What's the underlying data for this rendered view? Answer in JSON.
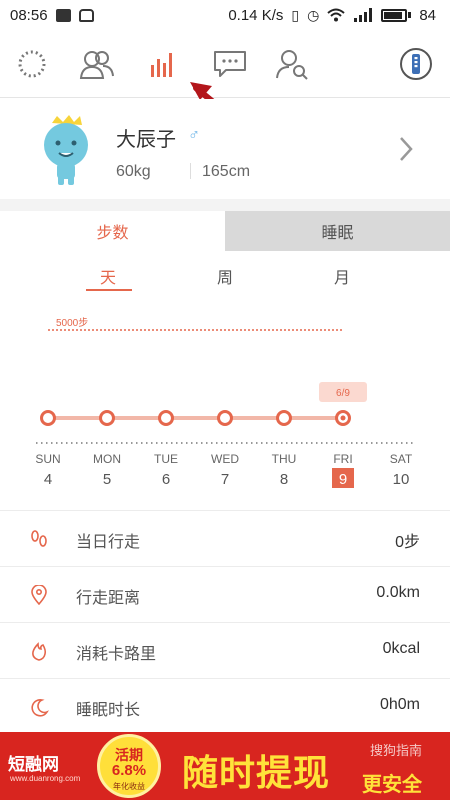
{
  "status_bar": {
    "time": "08:56",
    "speed": "0.14 K/s",
    "battery": "84"
  },
  "profile": {
    "name": "大辰子",
    "gender_symbol": "♂",
    "weight": "60kg",
    "height": "165cm"
  },
  "segment_tabs": {
    "steps": "步数",
    "sleep": "睡眠"
  },
  "period_tabs": {
    "day": "天",
    "week": "周",
    "month": "月"
  },
  "chart_data": {
    "type": "line",
    "goal_label": "5000步",
    "selected_label": "6/9",
    "categories": [
      "SUN",
      "MON",
      "TUE",
      "WED",
      "THU",
      "FRI",
      "SAT"
    ],
    "dates": [
      "4",
      "5",
      "6",
      "7",
      "8",
      "9",
      "10"
    ],
    "values": [
      0,
      0,
      0,
      0,
      0,
      0
    ],
    "goal": 5000,
    "selected_index": 5,
    "ylim": [
      0,
      5000
    ],
    "colors": {
      "accent": "#e5674c",
      "line": "#f2b7a8",
      "goal": "#e5674c"
    }
  },
  "stats": [
    {
      "label": "当日行走",
      "value": "0步",
      "icon": "footprints-icon"
    },
    {
      "label": "行走距离",
      "value": "0.0km",
      "icon": "location-pin-icon"
    },
    {
      "label": "消耗卡路里",
      "value": "0kcal",
      "icon": "flame-icon"
    },
    {
      "label": "睡眠时长",
      "value": "0h0m",
      "icon": "moon-icon"
    }
  ],
  "ad": {
    "brand": "短融网",
    "brand_sub": "www.duanrong.com",
    "circle_title": "活期",
    "circle_rate": "6.8%",
    "circle_sub": "年化收益",
    "slogan_main": "随时提现",
    "slogan_sub": "更安全",
    "watermark": "搜狗指南"
  },
  "colors": {
    "accent": "#e5674c",
    "ad_background": "#d8251f",
    "ad_text": "#ffe23a"
  }
}
